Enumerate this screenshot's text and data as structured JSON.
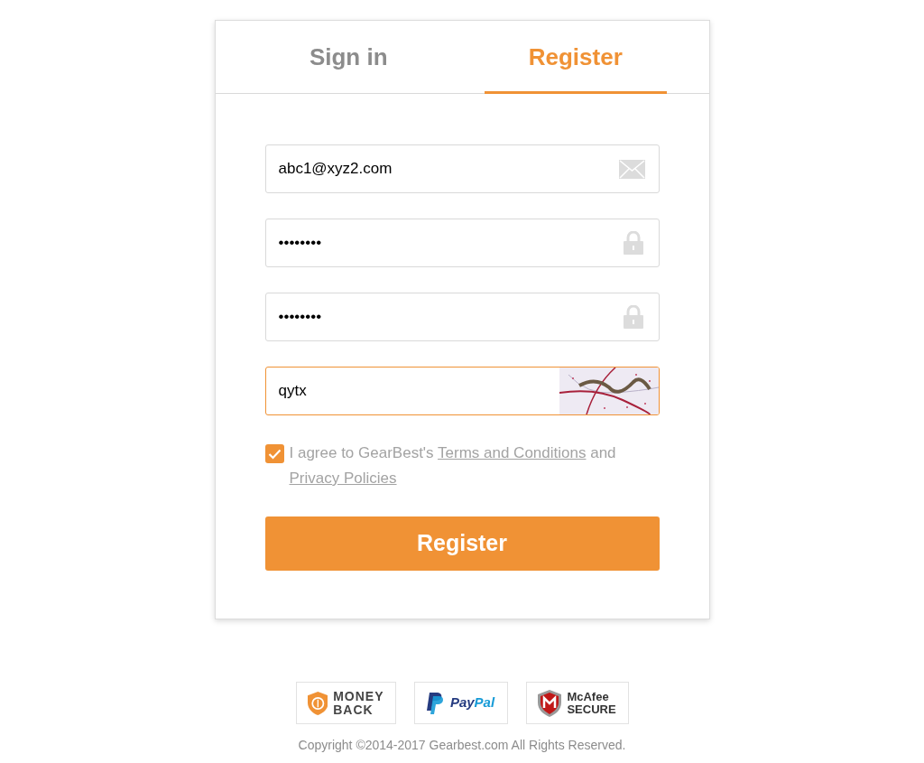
{
  "tabs": [
    {
      "label": "Sign in",
      "selected": false
    },
    {
      "label": "Register",
      "selected": true
    }
  ],
  "fields": [
    {
      "kind": "email",
      "value": "abc1@xyz2.com",
      "focused": false
    },
    {
      "kind": "password",
      "value": "••••••••",
      "focused": false
    },
    {
      "kind": "password",
      "value": "••••••••",
      "focused": false
    },
    {
      "kind": "captcha",
      "value": "qytx",
      "focused": true
    }
  ],
  "agreement": {
    "checked": true,
    "text_before": "I agree to GearBest's",
    "terms_link": "Terms and Conditions",
    "text_between": "and",
    "privacy_link": "Privacy Policies"
  },
  "submit_button": "Register",
  "badges": [
    {
      "kind": "money_back",
      "lines": [
        "MONEY",
        "BACK"
      ]
    },
    {
      "kind": "paypal",
      "parts": [
        "Pay",
        "Pal"
      ]
    },
    {
      "kind": "mcafee",
      "lines": [
        "McAfee",
        "SECURE"
      ]
    }
  ],
  "copyright": "Copyright ©2014-2017 Gearbest.com All Rights Reserved."
}
